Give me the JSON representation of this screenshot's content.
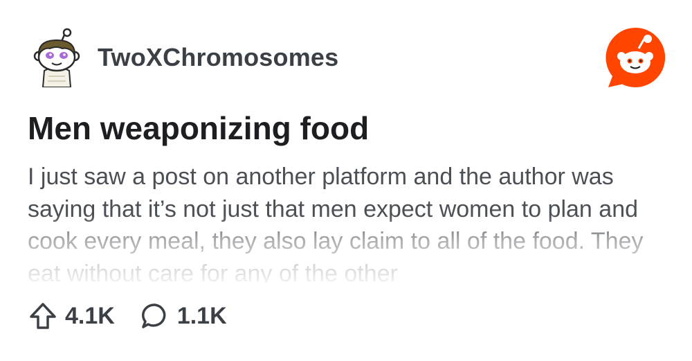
{
  "header": {
    "subreddit": "TwoXChromosomes",
    "avatar_icon": "snoo-avatar-icon",
    "brand_icon": "reddit-logo-icon",
    "brand_color": "#FF4500"
  },
  "post": {
    "title": "Men weaponizing food",
    "body": "I just saw a post on another platform and the author was saying that it’s not just that men expect women to plan and cook every meal, they also lay claim to all of the food. They eat without care for any of the other"
  },
  "stats": {
    "upvotes": "4.1K",
    "upvote_icon": "upvote-arrow-icon",
    "comments": "1.1K",
    "comment_icon": "comment-bubble-icon"
  }
}
